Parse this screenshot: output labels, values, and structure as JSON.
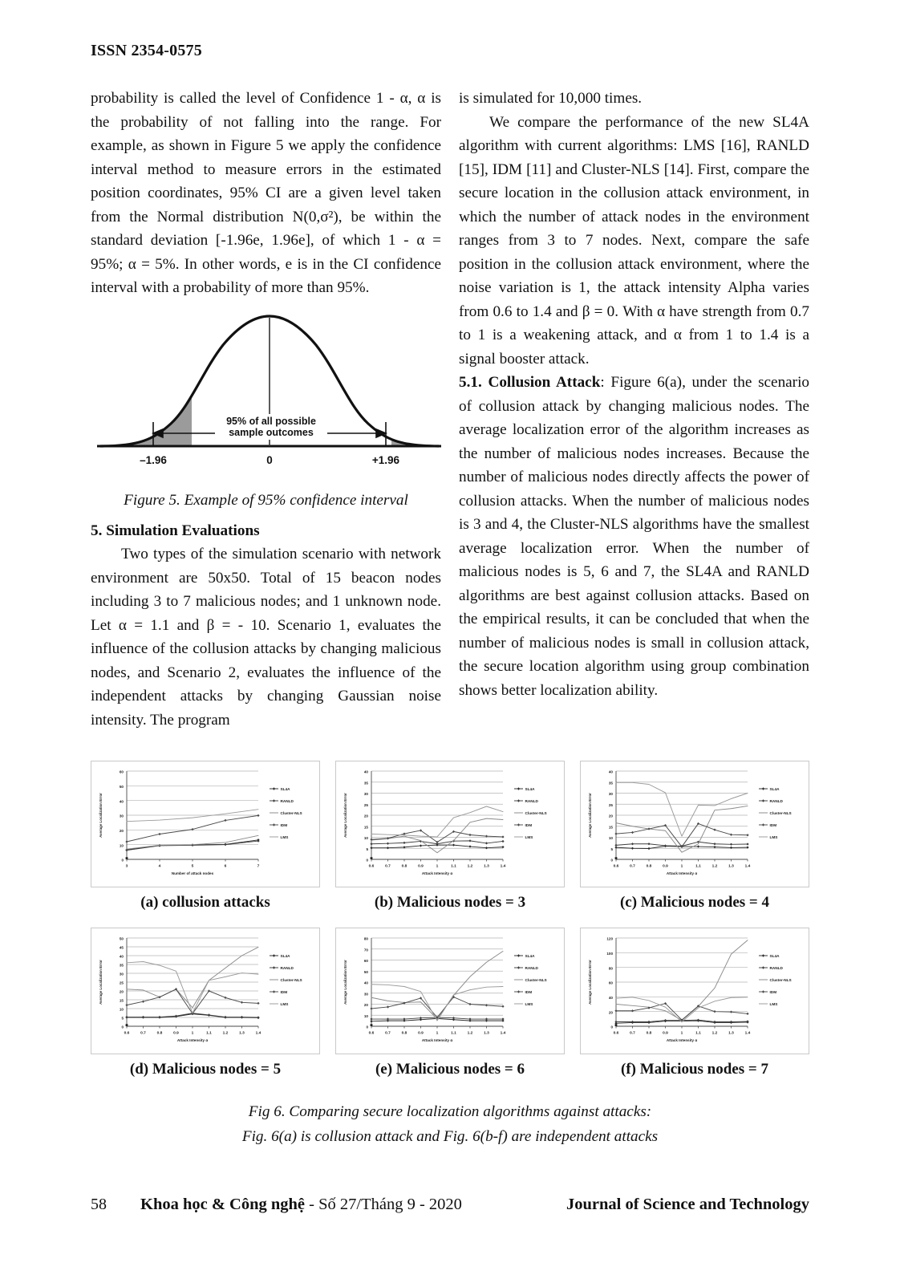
{
  "header": {
    "issn": "ISSN 2354-0575"
  },
  "left_column": {
    "para1": "probability is called the level of Confidence 1 - α, α is the probability of not falling into the range. For example, as shown in Figure 5 we apply the confidence interval method to measure errors in the estimated position coordinates, 95% CI are a given level taken from the Normal distribution N(0,σ²), be within the standard deviation [-1.96e, 1.96e], of which 1 - α = 95%; α = 5%. In other words, e is in the CI confidence interval with a probability of more than 95%.",
    "figure5": {
      "caption": "Figure 5. Example of 95% confidence interval",
      "annotation_line1": "95% of all possible",
      "annotation_line2": "sample outcomes",
      "tick_left": "–1.96",
      "tick_center": "0",
      "tick_right": "+1.96"
    },
    "section_heading": "5. Simulation Evaluations",
    "para2": "Two types of the simulation scenario with network environment are 50x50. Total of 15 beacon nodes including 3 to 7 malicious nodes; and 1 unknown node. Let α = 1.1 and β = - 10. Scenario 1, evaluates the influence of the collusion attacks by changing malicious nodes, and Scenario 2, evaluates the influence of the independent attacks by changing Gaussian noise intensity. The program"
  },
  "right_column": {
    "para1": "is simulated for 10,000 times.",
    "para2": "We compare the performance of the new SL4A algorithm with current algorithms: LMS [16], RANLD [15], IDM [11] and Cluster-NLS [14]. First, compare the secure location in the collusion attack environment, in which the number of attack nodes in the environment ranges from 3 to 7 nodes. Next, compare the safe position in the collusion attack environment, where the noise variation is 1, the attack intensity Alpha varies from 0.6 to 1.4 and β = 0. With α have strength from 0.7 to 1 is a weakening attack, and α from 1 to 1.4 is a signal booster attack.",
    "para3_heading": "5.1. Collusion Attack",
    "para3": ": Figure 6(a), under the scenario of collusion attack by changing malicious nodes. The average localization error of the algorithm increases as the number of malicious nodes increases. Because the number of malicious nodes directly affects the power of collusion attacks. When the number of malicious nodes is 3 and 4, the Cluster-NLS algorithms have the smallest average localization error. When the number of malicious nodes is 5, 6 and 7, the SL4A and RANLD algorithms are best against collusion attacks. Based on the empirical results, it can be concluded that when the number of malicious nodes is small in collusion attack, the secure location algorithm using group combination shows better localization ability."
  },
  "figure6": {
    "caption_line1": "Fig 6. Comparing secure localization algorithms against attacks:",
    "caption_line2": "Fig. 6(a) is collusion attack and Fig. 6(b-f) are independent attacks",
    "subcaptions": [
      "(a) collusion attacks",
      "(b) Malicious nodes = 3",
      "(c) Malicious nodes = 4",
      "(d) Malicious nodes = 5",
      "(e) Malicious nodes = 6",
      "(f) Malicious nodes = 7"
    ]
  },
  "chart_data": [
    {
      "id": "a",
      "type": "line",
      "title": "(a) collusion attacks",
      "xlabel": "Number of attack nodes",
      "ylabel": "Average Localization Error",
      "x": [
        3,
        4,
        5,
        6,
        7
      ],
      "xticks": [
        "3",
        "4",
        "5",
        "6",
        "7"
      ],
      "yticks": [
        "0",
        "10",
        "20",
        "30",
        "40",
        "50",
        "60"
      ],
      "ylim": [
        0,
        60
      ],
      "grid": true,
      "legend_position": "right",
      "series": [
        {
          "name": "SL4A",
          "values": [
            6.5,
            9.5,
            9.8,
            10.2,
            13.2
          ]
        },
        {
          "name": "RANLD",
          "values": [
            6.2,
            9.3,
            9.6,
            10.0,
            12.5
          ]
        },
        {
          "name": "Cluster-NLS",
          "values": [
            7.0,
            9.6,
            10.0,
            11.5,
            16.2
          ]
        },
        {
          "name": "IDM",
          "values": [
            12.0,
            17.2,
            20.4,
            26.5,
            29.8
          ]
        },
        {
          "name": "LMS",
          "values": [
            25.8,
            26.7,
            28.3,
            31.0,
            34.0
          ]
        }
      ]
    },
    {
      "id": "b",
      "type": "line",
      "title": "(b) Malicious nodes = 3",
      "xlabel": "Attack Intensity α",
      "ylabel": "Average Localization Error",
      "x": [
        0.6,
        0.7,
        0.8,
        0.9,
        1.0,
        1.1,
        1.2,
        1.3,
        1.4
      ],
      "xticks": [
        "0.6",
        "0.7",
        "0.8",
        "0.9",
        "1",
        "1.1",
        "1.2",
        "1.3",
        "1.4"
      ],
      "yticks": [
        "0",
        "5",
        "10",
        "15",
        "20",
        "25",
        "30",
        "35",
        "40"
      ],
      "ylim": [
        0,
        40
      ],
      "grid": true,
      "legend_position": "right",
      "series": [
        {
          "name": "SL4A",
          "values": [
            5.2,
            5.2,
            5.5,
            6.2,
            6.5,
            6.5,
            5.8,
            5.2,
            5.6
          ]
        },
        {
          "name": "RANLD",
          "values": [
            7.0,
            7.2,
            7.5,
            8.2,
            7.0,
            8.3,
            8.4,
            7.3,
            8.2
          ]
        },
        {
          "name": "Cluster-NLS",
          "values": [
            8.7,
            9.4,
            10.5,
            8.5,
            3.0,
            8.5,
            16.8,
            18.5,
            18.0
          ]
        },
        {
          "name": "IDM",
          "values": [
            9.0,
            9.5,
            11.6,
            13.1,
            7.8,
            12.6,
            11.1,
            10.5,
            10.2
          ]
        },
        {
          "name": "LMS",
          "values": [
            11.5,
            11.2,
            11.0,
            10.5,
            10.2,
            18.9,
            21.2,
            24.0,
            21.6
          ]
        }
      ]
    },
    {
      "id": "c",
      "type": "line",
      "title": "(c) Malicious nodes = 4",
      "xlabel": "Attack Intensity α",
      "ylabel": "Average Localization Error",
      "x": [
        0.6,
        0.7,
        0.8,
        0.9,
        1.0,
        1.1,
        1.2,
        1.3,
        1.4
      ],
      "xticks": [
        "0.6",
        "0.7",
        "0.8",
        "0.9",
        "1",
        "1.1",
        "1.2",
        "1.3",
        "1.4"
      ],
      "yticks": [
        "0",
        "5",
        "10",
        "15",
        "20",
        "25",
        "30",
        "35",
        "40"
      ],
      "ylim": [
        0,
        40
      ],
      "grid": true,
      "legend_position": "right",
      "series": [
        {
          "name": "SL4A",
          "values": [
            5.4,
            5.0,
            4.9,
            6.0,
            5.8,
            5.8,
            5.6,
            5.3,
            5.4
          ]
        },
        {
          "name": "RANLD",
          "values": [
            6.4,
            7.0,
            7.0,
            6.2,
            6.0,
            7.9,
            7.0,
            6.8,
            6.9
          ]
        },
        {
          "name": "Cluster-NLS",
          "values": [
            16.5,
            15.0,
            13.8,
            13.0,
            3.2,
            7.0,
            22.3,
            23.0,
            24.2
          ]
        },
        {
          "name": "IDM",
          "values": [
            11.6,
            12.2,
            13.8,
            15.4,
            5.7,
            16.2,
            13.4,
            11.2,
            11.0
          ]
        },
        {
          "name": "LMS",
          "values": [
            34.8,
            34.8,
            34.0,
            30.2,
            10.5,
            24.6,
            24.4,
            27.5,
            30.0
          ]
        }
      ]
    },
    {
      "id": "d",
      "type": "line",
      "title": "(d) Malicious nodes = 5",
      "xlabel": "Attack Intensity α",
      "ylabel": "Average Localization Error",
      "x": [
        0.6,
        0.7,
        0.8,
        0.9,
        1.0,
        1.1,
        1.2,
        1.3,
        1.4
      ],
      "xticks": [
        "0.6",
        "0.7",
        "0.8",
        "0.9",
        "1",
        "1.1",
        "1.2",
        "1.3",
        "1.4"
      ],
      "yticks": [
        "0",
        "5",
        "10",
        "15",
        "20",
        "25",
        "30",
        "35",
        "40",
        "45",
        "50"
      ],
      "ylim": [
        0,
        50
      ],
      "grid": true,
      "legend_position": "right",
      "series": [
        {
          "name": "SL4A",
          "values": [
            5.0,
            5.0,
            5.0,
            5.5,
            7.0,
            6.2,
            5.0,
            5.0,
            4.8
          ]
        },
        {
          "name": "RANLD",
          "values": [
            5.2,
            5.2,
            5.2,
            5.8,
            7.4,
            6.4,
            5.2,
            5.2,
            5.0
          ]
        },
        {
          "name": "Cluster-NLS",
          "values": [
            21.0,
            20.5,
            16.5,
            21.0,
            10.5,
            26.0,
            33.0,
            40.0,
            44.8
          ]
        },
        {
          "name": "IDM",
          "values": [
            12.0,
            14.0,
            16.5,
            21.0,
            7.2,
            20.0,
            16.2,
            13.5,
            13.0
          ]
        },
        {
          "name": "LMS",
          "values": [
            36.0,
            36.6,
            34.5,
            31.2,
            7.5,
            26.0,
            28.0,
            30.2,
            29.5
          ]
        }
      ]
    },
    {
      "id": "e",
      "type": "line",
      "title": "(e) Malicious nodes = 6",
      "xlabel": "Attack Intensity α",
      "ylabel": "Average Localization Error",
      "x": [
        0.6,
        0.7,
        0.8,
        0.9,
        1.0,
        1.1,
        1.2,
        1.3,
        1.4
      ],
      "xticks": [
        "0.6",
        "0.7",
        "0.8",
        "0.9",
        "1",
        "1.1",
        "1.2",
        "1.3",
        "1.4"
      ],
      "yticks": [
        "0",
        "10",
        "20",
        "30",
        "40",
        "50",
        "60",
        "70",
        "80"
      ],
      "ylim": [
        0,
        80
      ],
      "grid": true,
      "legend_position": "right",
      "series": [
        {
          "name": "SL4A",
          "values": [
            4.5,
            5.0,
            5.0,
            6.0,
            7.0,
            6.0,
            5.0,
            5.0,
            5.0
          ]
        },
        {
          "name": "RANLD",
          "values": [
            6.5,
            6.5,
            6.5,
            7.5,
            8.0,
            7.5,
            6.5,
            6.5,
            6.5
          ]
        },
        {
          "name": "Cluster-NLS",
          "values": [
            26.0,
            23.0,
            21.5,
            22.0,
            6.5,
            28.0,
            45.0,
            58.0,
            68.0
          ]
        },
        {
          "name": "IDM",
          "values": [
            16.0,
            17.5,
            21.0,
            25.5,
            8.0,
            26.5,
            20.0,
            19.0,
            18.0
          ]
        },
        {
          "name": "LMS",
          "values": [
            38.0,
            37.5,
            36.0,
            31.5,
            5.0,
            28.5,
            33.0,
            35.5,
            36.0
          ]
        }
      ]
    },
    {
      "id": "f",
      "type": "line",
      "title": "(f) Malicious nodes = 7",
      "xlabel": "Attack Intensity α",
      "ylabel": "Average Localization Error",
      "x": [
        0.6,
        0.7,
        0.8,
        0.9,
        1.0,
        1.1,
        1.2,
        1.3,
        1.4
      ],
      "xticks": [
        "0.6",
        "0.7",
        "0.8",
        "0.9",
        "1",
        "1.1",
        "1.2",
        "1.3",
        "1.4"
      ],
      "yticks": [
        "0",
        "20",
        "40",
        "60",
        "80",
        "100",
        "120"
      ],
      "ylim": [
        0,
        120
      ],
      "grid": true,
      "legend_position": "right",
      "series": [
        {
          "name": "SL4A",
          "values": [
            4.0,
            5.0,
            5.0,
            7.0,
            7.0,
            7.5,
            5.0,
            5.0,
            5.5
          ]
        },
        {
          "name": "RANLD",
          "values": [
            6.0,
            6.0,
            6.0,
            8.0,
            8.0,
            8.5,
            6.0,
            6.0,
            6.5
          ]
        },
        {
          "name": "Cluster-NLS",
          "values": [
            30.0,
            28.0,
            26.0,
            21.0,
            8.0,
            27.0,
            52.0,
            98.0,
            117.0
          ]
        },
        {
          "name": "IDM",
          "values": [
            21.0,
            21.0,
            25.0,
            31.0,
            8.5,
            27.5,
            20.0,
            19.5,
            17.0
          ]
        },
        {
          "name": "LMS",
          "values": [
            38.0,
            39.5,
            35.0,
            26.0,
            6.0,
            25.0,
            34.0,
            39.0,
            39.5
          ]
        }
      ]
    }
  ],
  "chart_legend_labels": [
    "SL4A",
    "RANLD",
    "Cluster-NLS",
    "IDM",
    "LMS"
  ],
  "footer": {
    "page_number": "58",
    "journal_vi_bold": "Khoa học & Công nghệ",
    "journal_vi_rest": " - Số 27/Tháng 9 - 2020",
    "journal_en": "Journal of Science and Technology"
  }
}
